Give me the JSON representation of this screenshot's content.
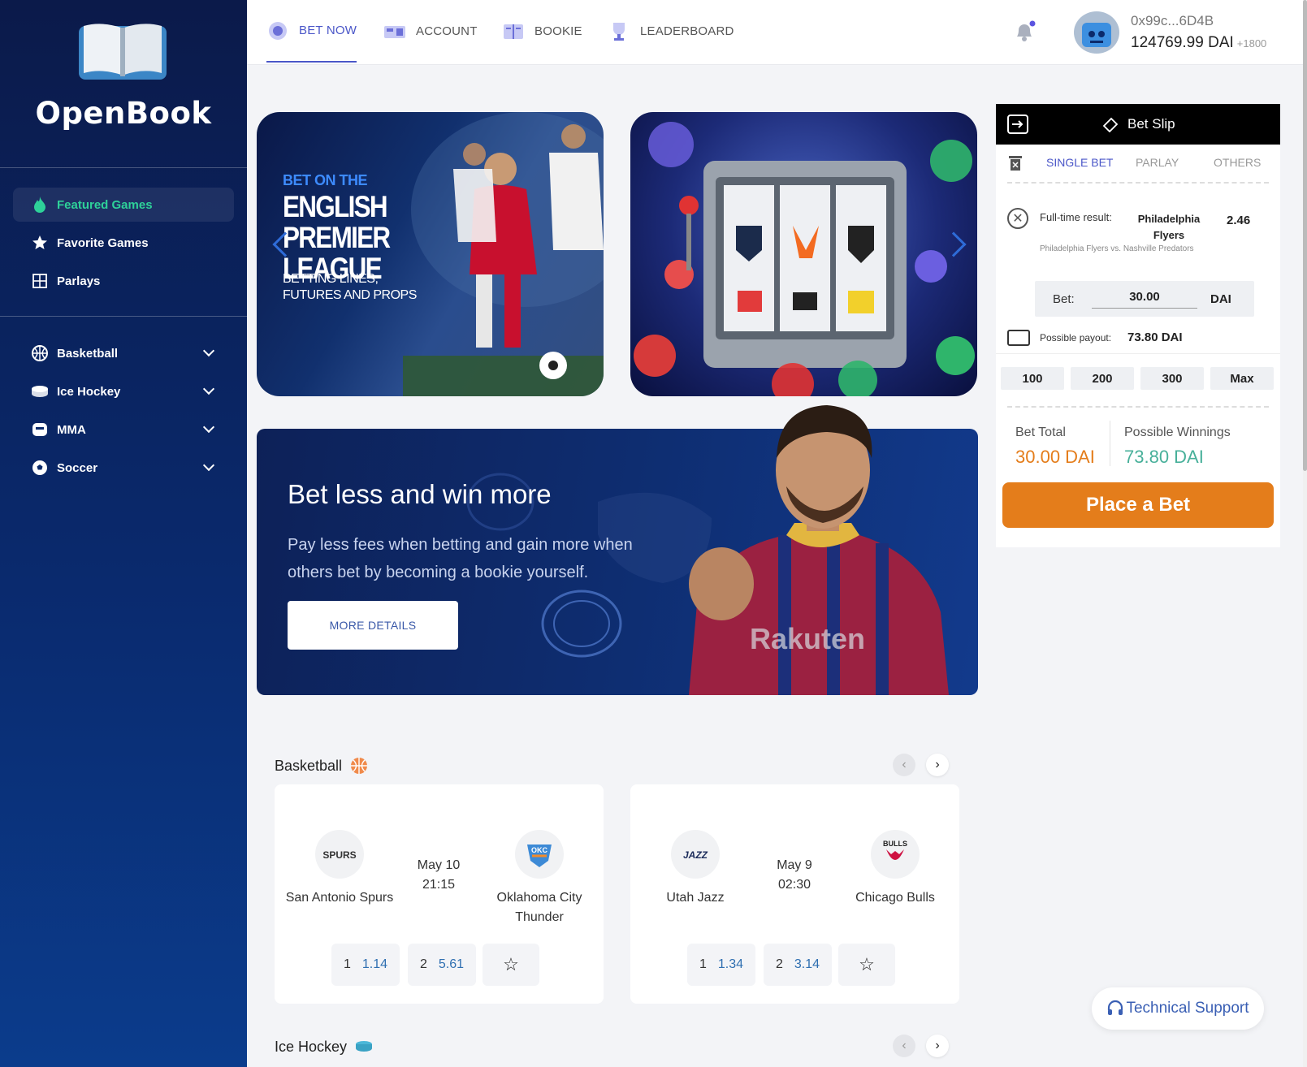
{
  "brand": {
    "name": "OpenBook",
    "icon": "open-book-icon"
  },
  "sidebar": {
    "nav": [
      {
        "label": "Featured Games",
        "icon": "flame-icon",
        "active": true
      },
      {
        "label": "Favorite Games",
        "icon": "star-icon",
        "active": false
      },
      {
        "label": "Parlays",
        "icon": "parlay-grid-icon",
        "active": false
      }
    ],
    "sports": [
      {
        "label": "Basketball",
        "icon": "basketball-icon"
      },
      {
        "label": "Ice Hockey",
        "icon": "puck-icon"
      },
      {
        "label": "MMA",
        "icon": "mma-glove-icon"
      },
      {
        "label": "Soccer",
        "icon": "soccer-ball-icon"
      }
    ]
  },
  "topbar": {
    "tabs": [
      {
        "label": "BET NOW",
        "icon": "chip-icon",
        "active": true
      },
      {
        "label": "ACCOUNT",
        "icon": "ticket-icon",
        "active": false
      },
      {
        "label": "BOOKIE",
        "icon": "book-icon",
        "active": false
      },
      {
        "label": "LEADERBOARD",
        "icon": "trophy-icon",
        "active": false
      }
    ],
    "notifications_icon": "bell-icon",
    "wallet": {
      "address": "0x99c...6D4B",
      "balance": "124769.99 DAI",
      "bonus": "+1800"
    }
  },
  "banners": {
    "epl": {
      "kicker": "BET ON THE",
      "title": "ENGLISH PREMIER LEAGUE",
      "subtitle": "BETTING LINES, FUTURES AND PROPS"
    },
    "promo": {
      "title": "Bet less and win more",
      "text": "Pay less fees when betting and gain more when others bet by becoming a bookie yourself.",
      "button": "MORE DETAILS"
    }
  },
  "betslip": {
    "title": "Bet Slip",
    "tabs": [
      "SINGLE BET",
      "PARLAY",
      "OTHERS"
    ],
    "active_tab": "SINGLE BET",
    "selection": {
      "market": "Full-time result:",
      "pick": "Philadelphia Flyers",
      "odds": "2.46",
      "match": "Philadelphia Flyers vs. Nashville Predators"
    },
    "bet_label": "Bet:",
    "bet_value": "30.00",
    "bet_unit": "DAI",
    "payout_label": "Possible payout:",
    "payout_value": "73.80 DAI",
    "quick_amounts": [
      "100",
      "200",
      "300",
      "Max"
    ],
    "total_label": "Bet Total",
    "total_value": "30.00 DAI",
    "winnings_label": "Possible Winnings",
    "winnings_value": "73.80 DAI",
    "place_button": "Place a Bet",
    "colors": {
      "accent": "#e47d1b",
      "winnings": "#48b09a"
    }
  },
  "sections": [
    {
      "title": "Basketball",
      "icon": "basketball-icon",
      "games": [
        {
          "home": "San Antonio Spurs",
          "home_abbr": "SPURS",
          "date": "May 10",
          "time": "21:15",
          "away": "Oklahoma City Thunder",
          "away_abbr": "OKC",
          "odds": [
            {
              "n": "1",
              "v": "1.14"
            },
            {
              "n": "2",
              "v": "5.61"
            }
          ]
        },
        {
          "home": "Utah Jazz",
          "home_abbr": "JAZZ",
          "date": "May 9",
          "time": "02:30",
          "away": "Chicago Bulls",
          "away_abbr": "BULLS",
          "odds": [
            {
              "n": "1",
              "v": "1.34"
            },
            {
              "n": "2",
              "v": "3.14"
            }
          ]
        }
      ]
    },
    {
      "title": "Ice Hockey",
      "icon": "puck-icon"
    }
  ],
  "support": {
    "label": "Technical Support",
    "icon": "headset-icon"
  }
}
